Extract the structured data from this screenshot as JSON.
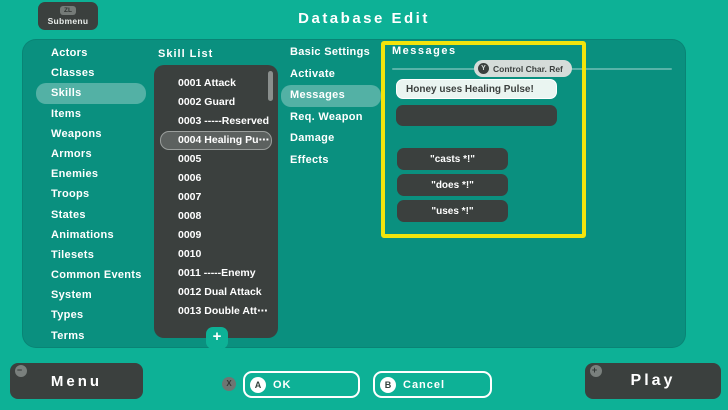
{
  "header": {
    "title": "Database Edit",
    "submenu": {
      "key": "ZL",
      "label": "Submenu"
    }
  },
  "sidebar": {
    "items": [
      "Actors",
      "Classes",
      "Skills",
      "Items",
      "Weapons",
      "Armors",
      "Enemies",
      "Troops",
      "States",
      "Animations",
      "Tilesets",
      "Common Events",
      "System",
      "Types",
      "Terms"
    ],
    "selected": "Skills"
  },
  "skill_list": {
    "title": "Skill List",
    "items": [
      "0001 Attack",
      "0002 Guard",
      "0003 -----Reserved",
      "0004 Healing Pu⋯",
      "0005",
      "0006",
      "0007",
      "0008",
      "0009",
      "0010",
      "0011 -----Enemy",
      "0012 Dual Attack",
      "0013 Double Att⋯"
    ],
    "selected": "0004 Healing Pu⋯",
    "add_label": "+"
  },
  "sections": {
    "items": [
      "Basic Settings",
      "Activate",
      "Messages",
      "Req. Weapon",
      "Damage",
      "Effects"
    ],
    "selected": "Messages"
  },
  "messages_panel": {
    "title": "Messages",
    "control_char_button": {
      "key": "Y",
      "label": "Control Char. Ref"
    },
    "use_message_line1": "Honey uses Healing Pulse!",
    "use_message_line2": "",
    "presets": [
      "\"casts *!\"",
      "\"does *!\"",
      "\"uses *!\""
    ]
  },
  "footer": {
    "menu": {
      "key": "−",
      "label": "Menu"
    },
    "ok_hint_key": "X",
    "ok": {
      "key": "A",
      "label": "OK"
    },
    "cancel": {
      "key": "B",
      "label": "Cancel"
    },
    "play": {
      "key": "+",
      "label": "Play"
    }
  },
  "colors": {
    "background": "#0DB196",
    "panel": "#0A907F",
    "dark_ui": "#3B403E",
    "selection_pill": "rgba(255,255,255,0.30)",
    "highlight_border": "#F2E40B",
    "light_input": "#EAF5F1"
  }
}
